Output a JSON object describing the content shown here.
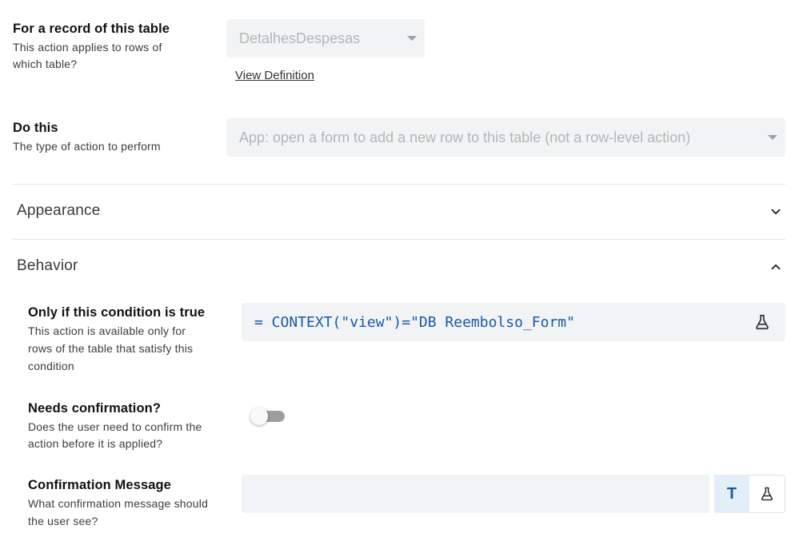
{
  "record_table": {
    "title": "For a record of this table",
    "description_line1": "This action applies to rows of",
    "description_line2": "which table?",
    "selected_table": "DetalhesDespesas",
    "view_definition_label": "View Definition"
  },
  "do_this": {
    "title": "Do this",
    "description": "The type of action to perform",
    "selected_action": "App: open a form to add a new row to this table (not a row-level action)"
  },
  "sections": {
    "appearance_label": "Appearance",
    "behavior_label": "Behavior"
  },
  "condition": {
    "title": "Only if this condition is true",
    "description_line1": "This action is available only for",
    "description_line2": "rows of the table that satisfy this",
    "description_line3": "condition",
    "expression": "= CONTEXT(\"view\")=\"DB Reembolso_Form\""
  },
  "confirmation": {
    "title": "Needs confirmation?",
    "description_line1": "Does the user need to confirm the",
    "description_line2": "action before it is applied?",
    "enabled": false
  },
  "confirmation_message": {
    "title": "Confirmation Message",
    "description_line1": "What confirmation message should",
    "description_line2": "the user see?",
    "value": "",
    "text_mode_label": "T"
  },
  "colors": {
    "accent_blue": "#1a5aa6",
    "field_bg": "#f1f3f4"
  }
}
